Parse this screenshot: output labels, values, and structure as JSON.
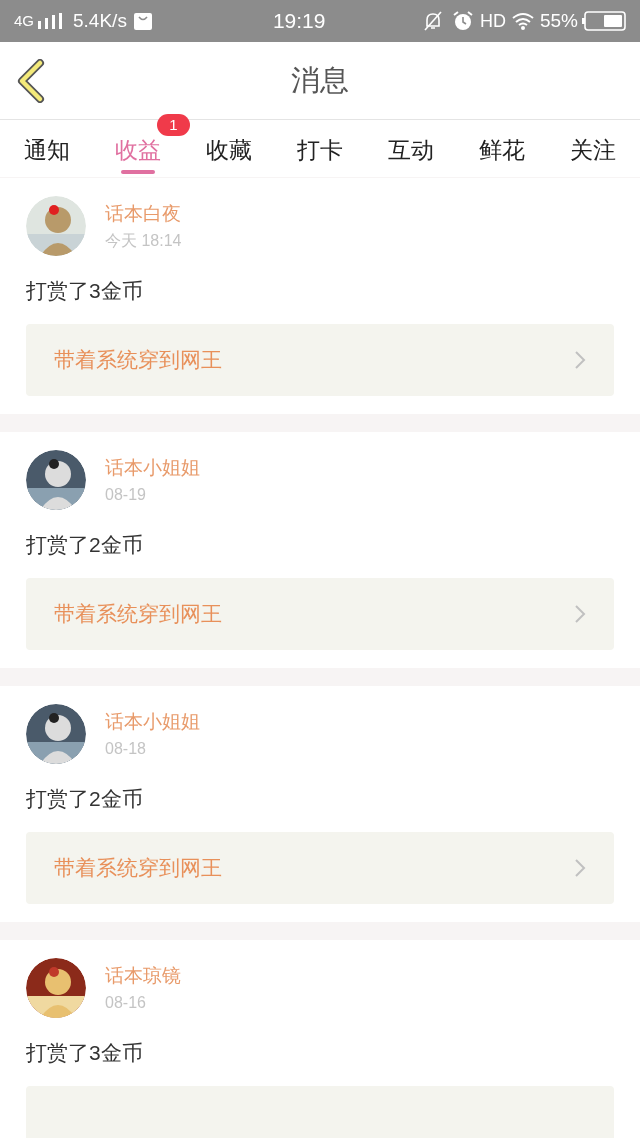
{
  "status_bar": {
    "network": "4G",
    "speed": "5.4K/s",
    "time": "19:19",
    "hd": "HD",
    "battery": "55%"
  },
  "header": {
    "title": "消息"
  },
  "tabs": [
    {
      "label": "通知",
      "selected": false
    },
    {
      "label": "收益",
      "selected": true,
      "badge": "1"
    },
    {
      "label": "收藏",
      "selected": false
    },
    {
      "label": "打卡",
      "selected": false
    },
    {
      "label": "互动",
      "selected": false
    },
    {
      "label": "鲜花",
      "selected": false
    },
    {
      "label": "关注",
      "selected": false
    }
  ],
  "messages": [
    {
      "user": "话本白夜",
      "time": "今天 18:14",
      "text": "打赏了3金币",
      "book": "带着系统穿到网王"
    },
    {
      "user": "话本小姐姐",
      "time": "08-19",
      "text": "打赏了2金币",
      "book": "带着系统穿到网王"
    },
    {
      "user": "话本小姐姐",
      "time": "08-18",
      "text": "打赏了2金币",
      "book": "带着系统穿到网王"
    },
    {
      "user": "话本琼镜",
      "time": "08-16",
      "text": "打赏了3金币"
    }
  ]
}
